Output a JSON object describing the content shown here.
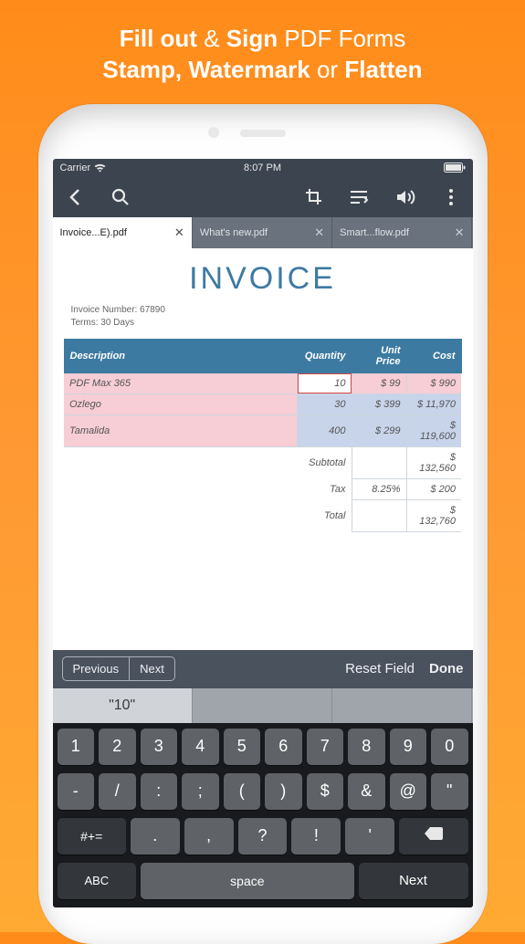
{
  "promo": {
    "line1_a": "Fill out",
    "line1_amp": "&",
    "line1_b": "Sign",
    "line1_rest": "PDF Forms",
    "line2_a": "Stamp, Watermark",
    "line2_or": "or",
    "line2_b": "Flatten"
  },
  "status": {
    "carrier": "Carrier",
    "time": "8:07 PM"
  },
  "tabs": [
    {
      "label": "Invoice...E).pdf",
      "active": true
    },
    {
      "label": "What's new.pdf",
      "active": false
    },
    {
      "label": "Smart...flow.pdf",
      "active": false
    }
  ],
  "doc": {
    "title": "INVOICE",
    "invoice_number_label": "Invoice Number: 67890",
    "terms_label": "Terms: 30 Days"
  },
  "table": {
    "headers": {
      "desc": "Description",
      "qty": "Quantity",
      "price": "Unit Price",
      "cost": "Cost"
    },
    "rows": [
      {
        "desc": "PDF Max 365",
        "qty": "10",
        "price": "$ 99",
        "cost": "$ 990"
      },
      {
        "desc": "Ozlego",
        "qty": "30",
        "price": "$ 399",
        "cost": "$ 11,970"
      },
      {
        "desc": "Tamalida",
        "qty": "400",
        "price": "$ 299",
        "cost": "$ 119,600"
      }
    ],
    "summary": [
      {
        "label": "Subtotal",
        "pct": "",
        "value": "$ 132,560"
      },
      {
        "label": "Tax",
        "pct": "8.25%",
        "value": "$ 200"
      },
      {
        "label": "Total",
        "pct": "",
        "value": "$ 132,760"
      }
    ]
  },
  "formbar": {
    "prev": "Previous",
    "next": "Next",
    "reset": "Reset Field",
    "done": "Done"
  },
  "suggestions": [
    "\"10\"",
    "",
    ""
  ],
  "keyboard": {
    "row1": [
      "1",
      "2",
      "3",
      "4",
      "5",
      "6",
      "7",
      "8",
      "9",
      "0"
    ],
    "row2": [
      "-",
      "/",
      ":",
      ";",
      "(",
      ")",
      "$",
      "&",
      "@",
      "\""
    ],
    "row3_shift": "#+=",
    "row3": [
      ".",
      ",",
      "?",
      "!",
      "'"
    ],
    "row4_abc": "ABC",
    "row4_space": "space",
    "row4_next": "Next"
  }
}
